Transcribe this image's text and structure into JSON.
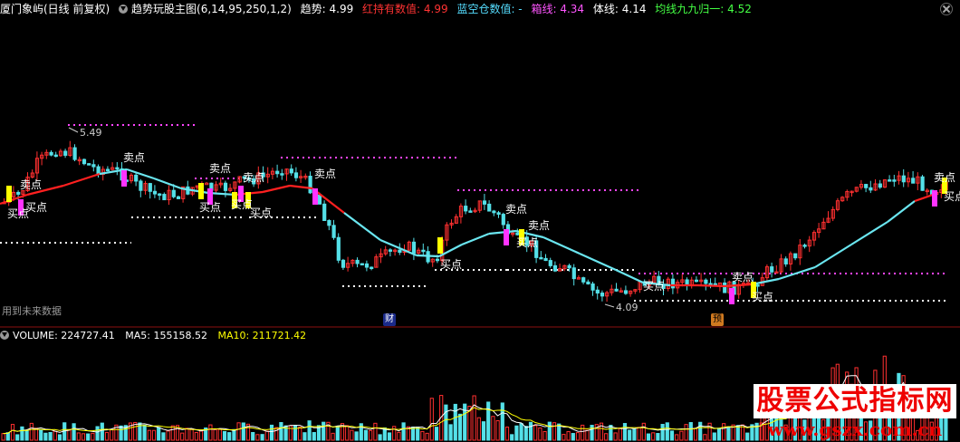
{
  "header": {
    "title": "厦门象屿(日线 前复权)",
    "indicator": "趋势玩股主图(6,14,95,250,1,2)",
    "items": [
      {
        "label": "趋势: 4.99",
        "color": "#ffffff"
      },
      {
        "label": "红持有数值: 4.99",
        "color": "#ff3333"
      },
      {
        "label": "蓝空仓数值: -",
        "color": "#55ddff"
      },
      {
        "label": "箱线: 4.34",
        "color": "#ff55ff"
      },
      {
        "label": "体线: 4.14",
        "color": "#ffffff"
      },
      {
        "label": "均线九九归一: 4.52",
        "color": "#44ff44"
      }
    ]
  },
  "price_chart": {
    "high_label": "5.49",
    "low_label": "4.09",
    "buy_label": "买点",
    "sell_label": "卖点",
    "future_label": "用到未来数据",
    "badge_finance": "财",
    "badge_forecast": "预"
  },
  "volume_panel": {
    "volume": "VOLUME: 224727.41",
    "ma5": "MA5: 155158.52",
    "ma10": "MA10: 211721.42"
  },
  "watermark": {
    "line1": "股票公式指标网",
    "line2": "www.gszx.com.cn"
  },
  "colors": {
    "up": "#ff3030",
    "down": "#54e0e8",
    "trend_up": "#ff2020",
    "trend_down": "#6ae6f0",
    "box": "#ff44ff",
    "buy_bar": "#ffff00",
    "sell_bar": "#ff33ff"
  }
}
